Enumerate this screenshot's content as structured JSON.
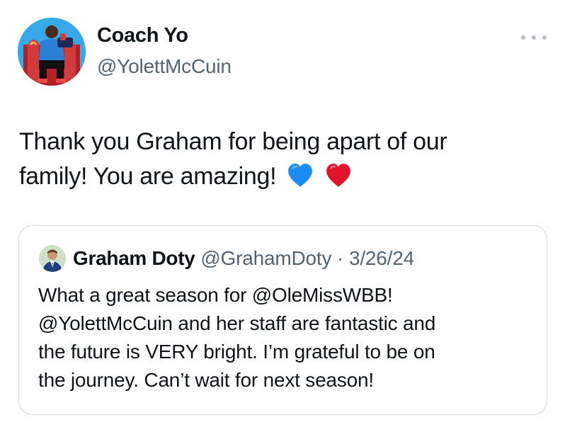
{
  "author": {
    "name": "Coach Yo",
    "handle": "@YolettMcCuin"
  },
  "tweet": {
    "text_line1": "Thank you Graham for being apart of our",
    "text_line2": "family! You are amazing!",
    "emojis": [
      "blue-heart",
      "red-heart"
    ]
  },
  "quoted_tweet": {
    "name": "Graham Doty",
    "handle": "@GrahamDoty",
    "separator": "·",
    "date": "3/26/24",
    "lines": [
      "What a great season for @OleMissWBB!",
      "@YolettMcCuin and her staff are fantastic and",
      "the future is VERY bright. I’m grateful to be on",
      "the journey. Can’t wait for next season!"
    ]
  },
  "colors": {
    "text_primary": "#0f1419",
    "text_secondary": "#536471",
    "border": "#cfd9de",
    "blue_heart": "#1d8cf0",
    "red_heart": "#e0142a"
  }
}
